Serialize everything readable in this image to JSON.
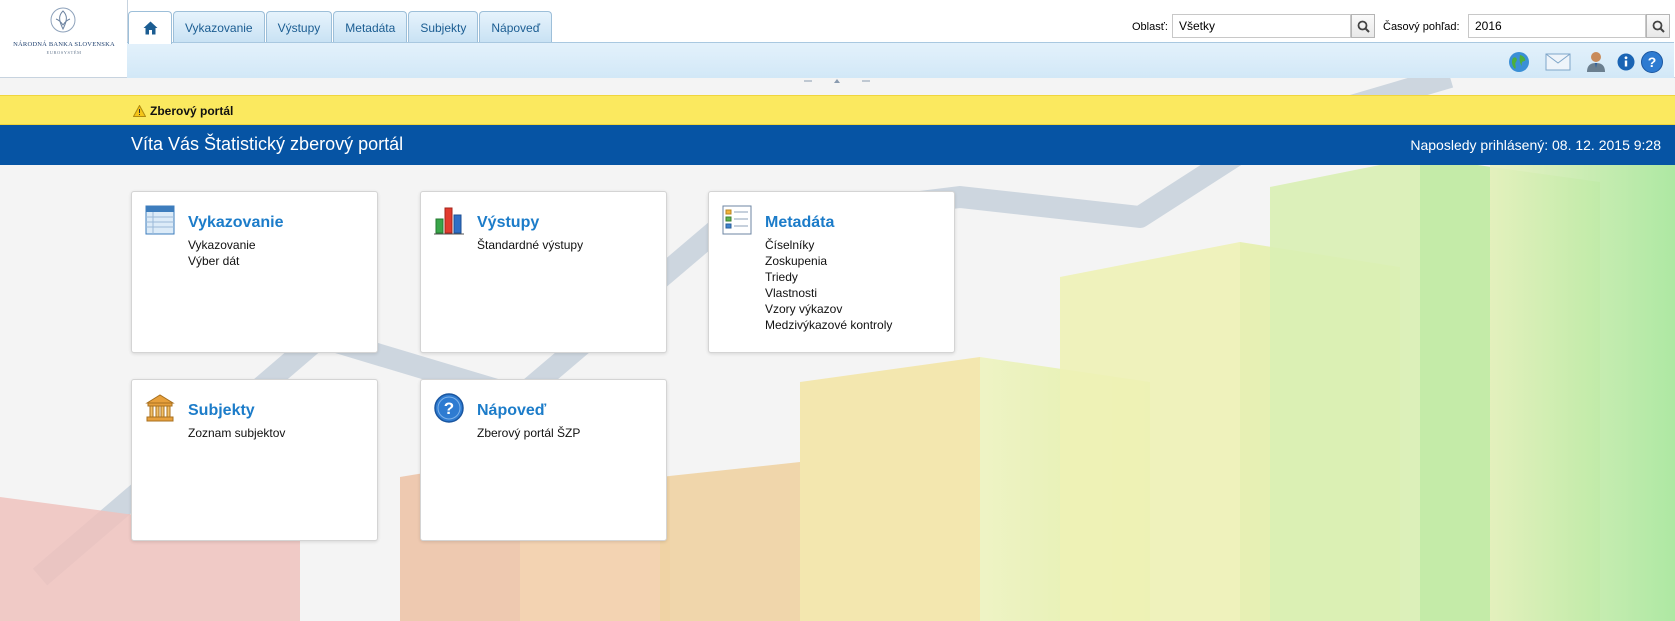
{
  "logo": {
    "name": "NÁRODNÁ BANKA SLOVENSKA",
    "sub": "EUROSYSTÉM"
  },
  "nav": {
    "home_icon": "home-icon",
    "tabs": [
      "Vykazovanie",
      "Výstupy",
      "Metadáta",
      "Subjekty",
      "Nápoveď"
    ]
  },
  "filters": {
    "oblast_label": "Oblasť:",
    "oblast_value": "Všetky",
    "cas_label": "Časový pohľad:",
    "cas_value": "2016"
  },
  "toolbar_icons": [
    "globe-icon",
    "mail-icon",
    "user-icon",
    "info-icon",
    "help-icon"
  ],
  "notice": {
    "text": "Zberový portál",
    "icon": "warning-icon"
  },
  "banner": {
    "title": "Víta Vás Štatistický zberový portál",
    "last_login": "Naposledy prihlásený: 08. 12. 2015 9:28"
  },
  "cards": [
    {
      "title": "Vykazovanie",
      "icon": "calendar-icon",
      "links": [
        "Vykazovanie",
        "Výber dát"
      ]
    },
    {
      "title": "Výstupy",
      "icon": "bar-chart-icon",
      "links": [
        "Štandardné výstupy"
      ]
    },
    {
      "title": "Metadáta",
      "icon": "list-icon",
      "links": [
        "Číselníky",
        "Zoskupenia",
        "Triedy",
        "Vlastnosti",
        "Vzory výkazov",
        "Medzivýkazové kontroly"
      ]
    },
    {
      "title": "Subjekty",
      "icon": "bank-icon",
      "links": [
        "Zoznam subjektov"
      ]
    },
    {
      "title": "Nápoveď",
      "icon": "question-icon",
      "links": [
        "Zberový portál ŠZP"
      ]
    }
  ],
  "colors": {
    "brand_blue": "#0654a4",
    "notice_yellow": "#fbe95f",
    "link_blue": "#1c7cc9"
  }
}
